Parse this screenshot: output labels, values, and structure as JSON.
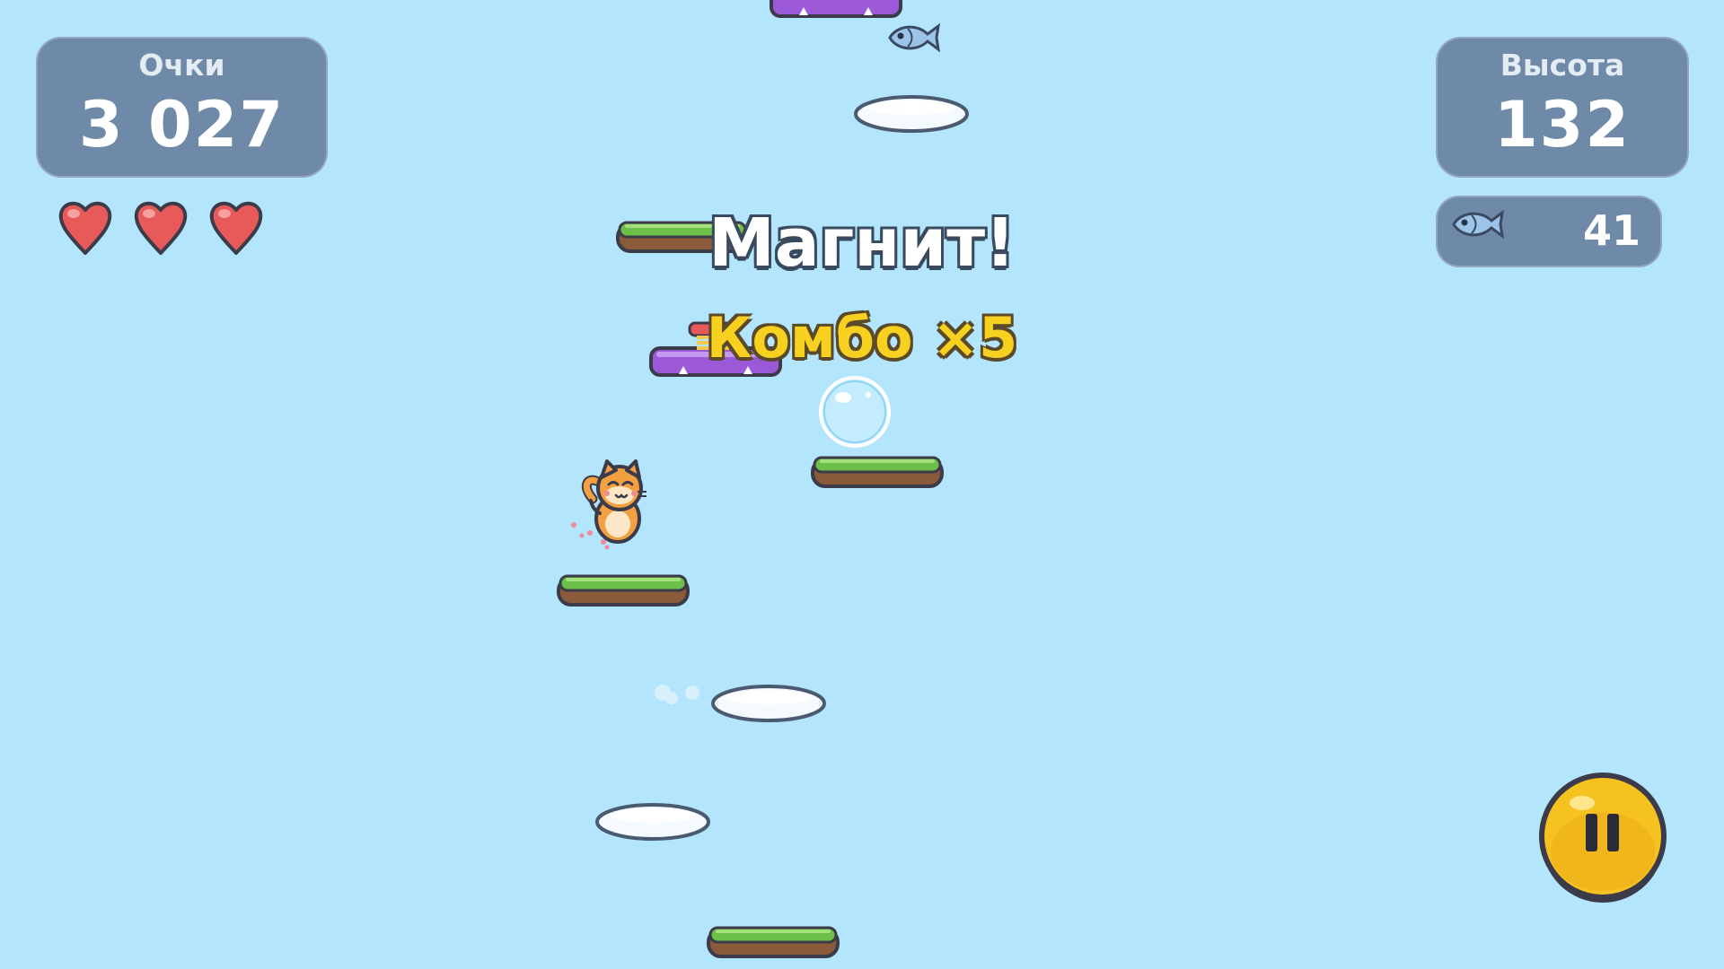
{
  "hud": {
    "score_label": "Очки",
    "score_value": "3 027",
    "height_label": "Высота",
    "height_value": "132",
    "fish_count": "41",
    "lives": 3
  },
  "popups": {
    "power_up": "Магнит!",
    "combo": "Комбо ×5"
  },
  "colors": {
    "sky": "#b3e5fc",
    "hud_panel": "#6f89a8",
    "grass": "#6cc04a",
    "dirt": "#8a5a3a",
    "spring_platform": "#9b59d8",
    "cloud": "#f4faff",
    "heart": "#e85a5a",
    "combo_text": "#f8d020",
    "pause_button": "#f6c21f"
  },
  "icons": {
    "lives": "heart-icon",
    "fish": "fish-icon",
    "pause": "pause-icon",
    "player": "cat-character",
    "bubble": "magnet-bubble"
  }
}
